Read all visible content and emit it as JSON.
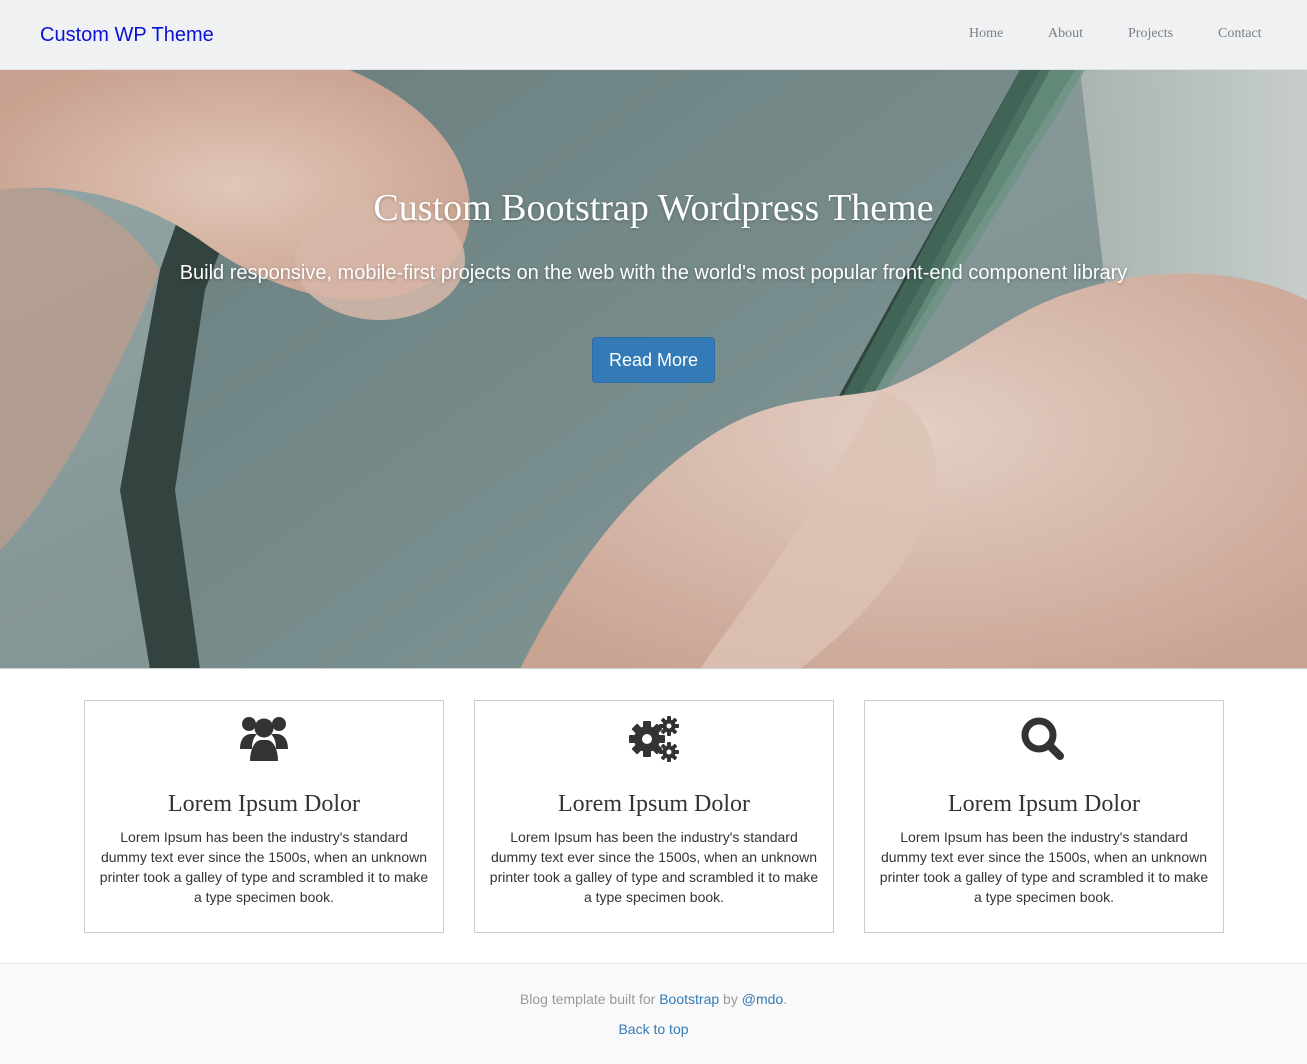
{
  "navbar": {
    "brand": "Custom WP Theme",
    "links": [
      "Home",
      "About",
      "Projects",
      "Contact"
    ]
  },
  "hero": {
    "title": "Custom Bootstrap Wordpress Theme",
    "subtitle": "Build responsive, mobile-first projects on the web with the world's most popular front-end component library",
    "button": "Read More"
  },
  "features": [
    {
      "icon": "users-icon",
      "title": "Lorem Ipsum Dolor",
      "text": "Lorem Ipsum has been the industry's standard dummy text ever since the 1500s, when an unknown printer took a galley of type and scrambled it to make a type specimen book."
    },
    {
      "icon": "cogs-icon",
      "title": "Lorem Ipsum Dolor",
      "text": "Lorem Ipsum has been the industry's standard dummy text ever since the 1500s, when an unknown printer took a galley of type and scrambled it to make a type specimen book."
    },
    {
      "icon": "search-icon",
      "title": "Lorem Ipsum Dolor",
      "text": "Lorem Ipsum has been the industry's standard dummy text ever since the 1500s, when an unknown printer took a galley of type and scrambled it to make a type specimen book."
    }
  ],
  "footer": {
    "prefix": "Blog template built for ",
    "bootstrap_link": "Bootstrap",
    "by": " by ",
    "author_link": "@mdo",
    "suffix": ".",
    "back_to_top": "Back to top"
  },
  "colors": {
    "brand": "#0a12d6",
    "primary": "#337ab7",
    "navbar_bg": "#eff1f2",
    "icon": "#333333"
  }
}
